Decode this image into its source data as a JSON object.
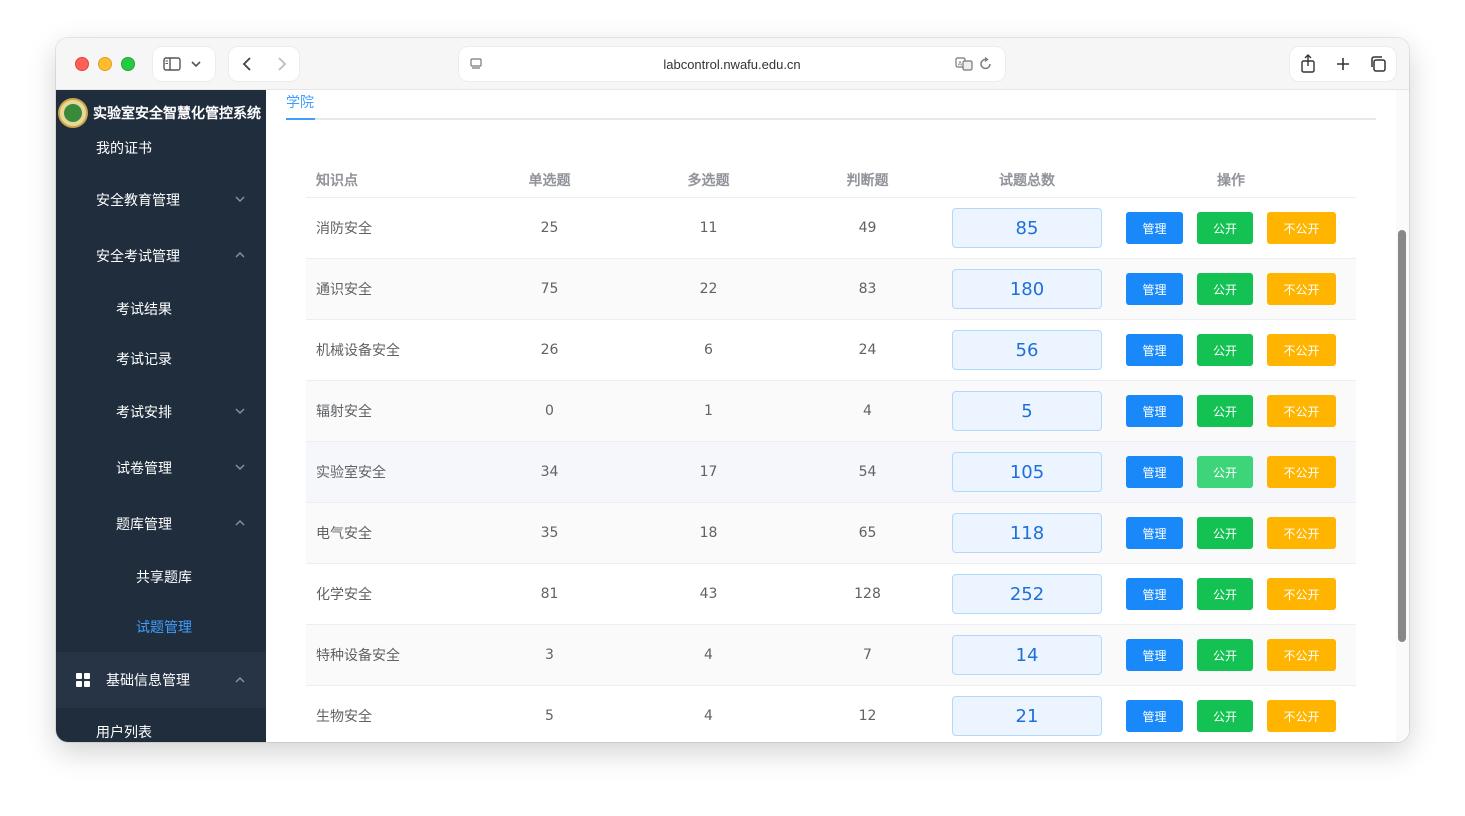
{
  "browser": {
    "url": "labcontrol.nwafu.edu.cn"
  },
  "app": {
    "title": "实验室安全智慧化管控系统"
  },
  "sidebar": {
    "items": [
      {
        "label": "我的证书",
        "level": 1
      },
      {
        "label": "安全教育管理",
        "level": 1,
        "expanded": false
      },
      {
        "label": "安全考试管理",
        "level": 1,
        "expanded": true
      },
      {
        "label": "考试结果",
        "level": 2
      },
      {
        "label": "考试记录",
        "level": 2
      },
      {
        "label": "考试安排",
        "level": 2,
        "expanded": false
      },
      {
        "label": "试卷管理",
        "level": 2,
        "expanded": false
      },
      {
        "label": "题库管理",
        "level": 2,
        "expanded": true
      },
      {
        "label": "共享题库",
        "level": 3
      },
      {
        "label": "试题管理",
        "level": 3,
        "active": true
      },
      {
        "label": "基础信息管理",
        "level": 1,
        "expanded": true,
        "icon": "grid-icon"
      },
      {
        "label": "用户列表",
        "level": 1
      }
    ]
  },
  "tabs": [
    {
      "label": "学院",
      "active": true
    }
  ],
  "table": {
    "headers": [
      "知识点",
      "单选题",
      "多选题",
      "判断题",
      "试题总数",
      "操作"
    ],
    "actions": {
      "manage": "管理",
      "public": "公开",
      "private": "不公开"
    },
    "rows": [
      {
        "name": "消防安全",
        "single": "25",
        "multi": "11",
        "judge": "49",
        "total": "85"
      },
      {
        "name": "通识安全",
        "single": "75",
        "multi": "22",
        "judge": "83",
        "total": "180"
      },
      {
        "name": "机械设备安全",
        "single": "26",
        "multi": "6",
        "judge": "24",
        "total": "56"
      },
      {
        "name": "辐射安全",
        "single": "0",
        "multi": "1",
        "judge": "4",
        "total": "5"
      },
      {
        "name": "实验室安全",
        "single": "34",
        "multi": "17",
        "judge": "54",
        "total": "105"
      },
      {
        "name": "电气安全",
        "single": "35",
        "multi": "18",
        "judge": "65",
        "total": "118"
      },
      {
        "name": "化学安全",
        "single": "81",
        "multi": "43",
        "judge": "128",
        "total": "252"
      },
      {
        "name": "特种设备安全",
        "single": "3",
        "multi": "4",
        "judge": "7",
        "total": "14"
      },
      {
        "name": "生物安全",
        "single": "5",
        "multi": "4",
        "judge": "12",
        "total": "21"
      }
    ]
  },
  "colors": {
    "sidebar_bg": "#1f2d3d",
    "accent": "#409eff",
    "manage": "#1989fa",
    "public": "#13c252",
    "private": "#ffb400"
  }
}
